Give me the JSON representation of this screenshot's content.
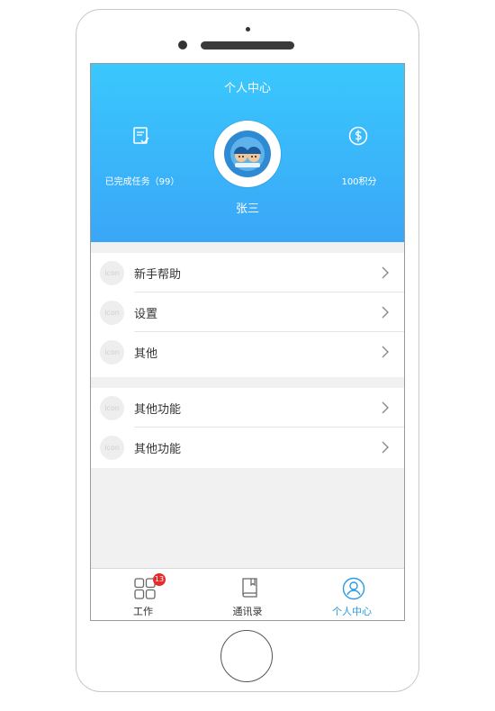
{
  "header": {
    "title": "个人中心",
    "tasks_label": "已完成任务（99）",
    "points_label": "100积分",
    "username": "张三"
  },
  "menu": {
    "group1": [
      {
        "icon_text": "icon",
        "label": "新手帮助"
      },
      {
        "icon_text": "icon",
        "label": "设置"
      },
      {
        "icon_text": "icon",
        "label": "其他"
      }
    ],
    "group2": [
      {
        "icon_text": "icon",
        "label": "其他功能"
      },
      {
        "icon_text": "icon",
        "label": "其他功能"
      }
    ]
  },
  "tabbar": {
    "items": [
      {
        "label": "工作",
        "icon": "grid-icon",
        "badge": "13"
      },
      {
        "label": "通讯录",
        "icon": "book-icon"
      },
      {
        "label": "个人中心",
        "icon": "user-icon",
        "active": true
      }
    ]
  },
  "colors": {
    "header_top": "#3ac8fd",
    "header_bottom": "#3aa6f7",
    "active_tab": "#2a9be3",
    "badge": "#e62b2b"
  }
}
